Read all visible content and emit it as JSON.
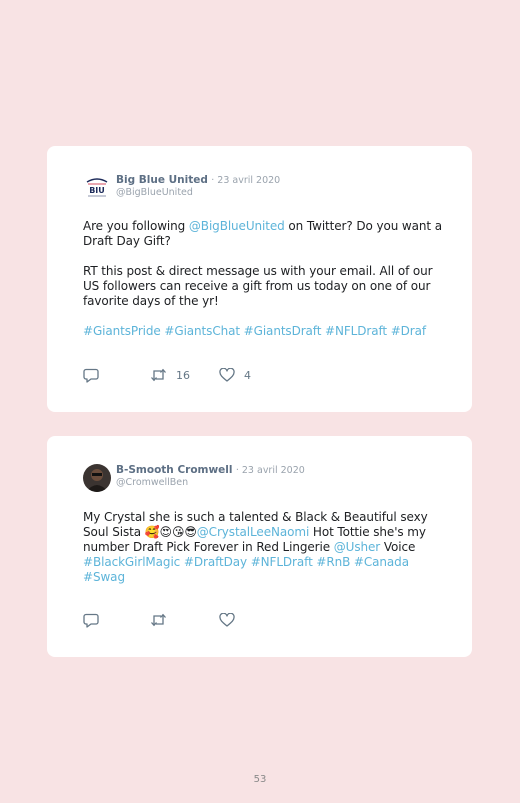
{
  "tweets": [
    {
      "name": "Big Blue United",
      "date": "· 23 avril 2020",
      "handle": "@BigBlueUnited",
      "p1_a": "Are you following ",
      "p1_mention": "@BigBlueUnited",
      "p1_b": " on Twitter? Do you want a Draft Day Gift?",
      "p2": "RT this post & direct message us with your email. All of our US followers can receive a gift from us today on one of our favorite days of the yr!",
      "hashtags": "#GiantsPride #GiantsChat #GiantsDraft #NFLDraft #Draf",
      "retweets": "16",
      "likes": "4",
      "avatar_text": "BIU"
    },
    {
      "name": "B-Smooth Cromwell",
      "date": "· 23 avril 2020",
      "handle": "@CromwellBen",
      "text_a": "My Crystal she is such a talented & Black & Beautiful sexy Soul Sista ",
      "emojis": "🥰😍😘😎",
      "mention1": "@CrystalLeeNaomi",
      "text_b": " Hot Tottie she's my number Draft Pick Forever in Red Lingerie ",
      "mention2": "@Usher",
      "text_c": " Voice ",
      "hashtags": "#BlackGirlMagic #DraftDay #NFLDraft #RnB #Canada #Swag"
    }
  ],
  "page_number": "53",
  "colors": {
    "background": "#f8e3e4",
    "link": "#5db4d9",
    "name": "#5d6f84"
  },
  "icons": [
    "reply-icon",
    "retweet-icon",
    "heart-icon"
  ]
}
